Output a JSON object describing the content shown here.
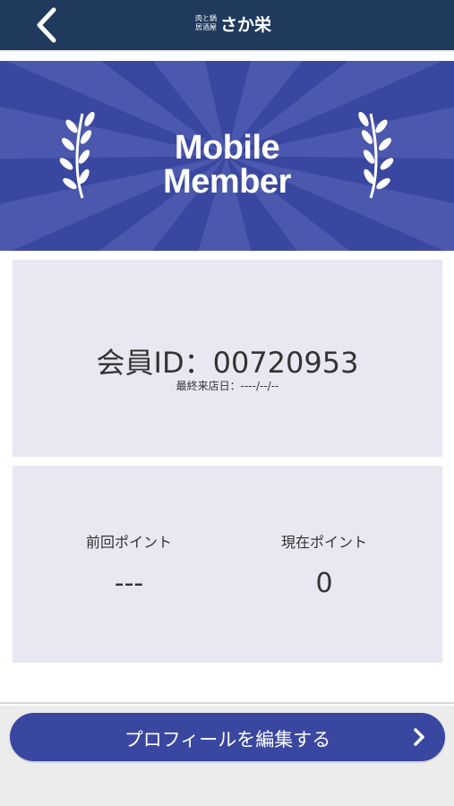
{
  "header": {
    "logo_small_line1": "肉と鍋",
    "logo_small_line2": "居酒屋",
    "logo_big": "さか栄",
    "back_icon": "chevron-left-icon"
  },
  "banner": {
    "title_line1": "Mobile",
    "title_line2": "Member",
    "left_icon": "laurel-icon",
    "right_icon": "laurel-icon",
    "color": "#3a47a0"
  },
  "member": {
    "id_text": "会員ID：00720953",
    "last_visit": "最終来店日：----/--/--"
  },
  "points": {
    "previous_label": "前回ポイント",
    "previous_value": "---",
    "current_label": "現在ポイント",
    "current_value": "0"
  },
  "edit_profile": {
    "label": "プロフィールを編集する",
    "icon": "chevron-right-icon"
  },
  "colors": {
    "header": "#1f3a5c",
    "accent": "#3a47a0",
    "card": "#e8e8f2"
  }
}
